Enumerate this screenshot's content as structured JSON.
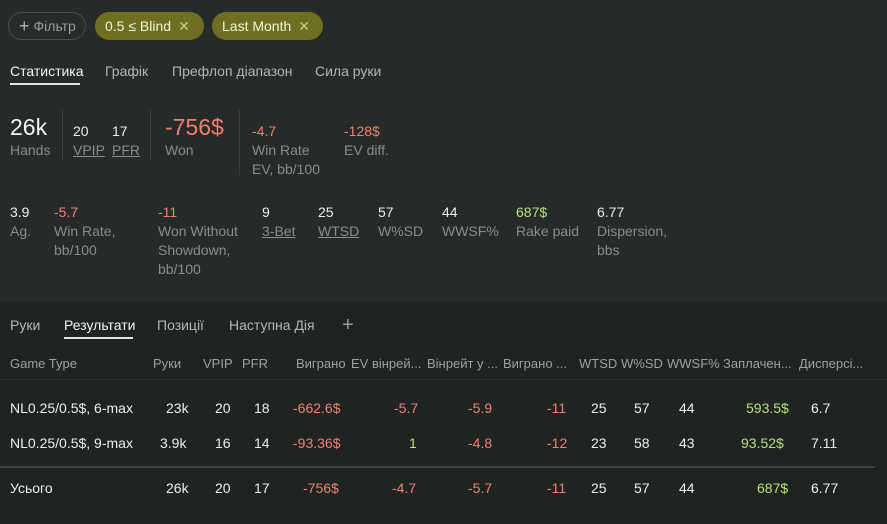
{
  "filters": {
    "add_label": "Фільтр",
    "chips": [
      "0.5 ≤ Blind",
      "Last Month"
    ]
  },
  "tabs": [
    "Статистика",
    "Графік",
    "Префлоп діапазон",
    "Сила руки"
  ],
  "summary": {
    "hands": {
      "value": "26k",
      "label": "Hands"
    },
    "vpip": {
      "value": "20",
      "label": "VPIP"
    },
    "pfr": {
      "value": "17",
      "label": "PFR"
    },
    "won": {
      "value": "-756$",
      "label": "Won"
    },
    "winrate_ev": {
      "value": "-4.7",
      "label": "Win Rate EV, bb/100"
    },
    "ev_diff": {
      "value": "-128$",
      "label": "EV diff."
    }
  },
  "stats_row": {
    "ag": {
      "value": "3.9",
      "label": "Ag."
    },
    "winrate": {
      "value": "-5.7",
      "label": "Win Rate, bb/100"
    },
    "won_wo_sd": {
      "value": "-11",
      "label": "Won Without Showdown, bb/100"
    },
    "three_bet": {
      "value": "9",
      "label": "3-Bet"
    },
    "wtsd": {
      "value": "25",
      "label": "WTSD"
    },
    "wsd": {
      "value": "57",
      "label": "W%SD"
    },
    "wwsf": {
      "value": "44",
      "label": "WWSF%"
    },
    "rake": {
      "value": "687$",
      "label": "Rake paid"
    },
    "dispersion": {
      "value": "6.77",
      "label": "Dispersion, bbs"
    }
  },
  "subtabs": [
    "Руки",
    "Результати",
    "Позиції",
    "Наступна Дія"
  ],
  "table": {
    "headers": [
      "Game Type",
      "Руки",
      "VPIP",
      "PFR",
      "Виграно",
      "EV вінрей...",
      "Вінрейт у ...",
      "Виграно ...",
      "WTSD",
      "W%SD",
      "WWSF%",
      "Заплачен...",
      "Дисперсі..."
    ],
    "rows": [
      [
        "NL0.25/0.5$, 6-max",
        "23k",
        "20",
        "18",
        "-662.6$",
        "-5.7",
        "-5.9",
        "-11",
        "25",
        "57",
        "44",
        "593.5$",
        "6.7"
      ],
      [
        "NL0.25/0.5$, 9-max",
        "3.9k",
        "16",
        "14",
        "-93.36$",
        "1",
        "-4.8",
        "-12",
        "23",
        "58",
        "43",
        "93.52$",
        "7.11"
      ]
    ],
    "total": [
      "Усього",
      "26k",
      "20",
      "17",
      "-756$",
      "-4.7",
      "-5.7",
      "-11",
      "25",
      "57",
      "44",
      "687$",
      "6.77"
    ]
  },
  "colors": {
    "background": "#262a28",
    "panel": "#1f2321",
    "chip_olive": "#6f6f22",
    "negative": "#f08272",
    "positive": "#b8e07a"
  }
}
